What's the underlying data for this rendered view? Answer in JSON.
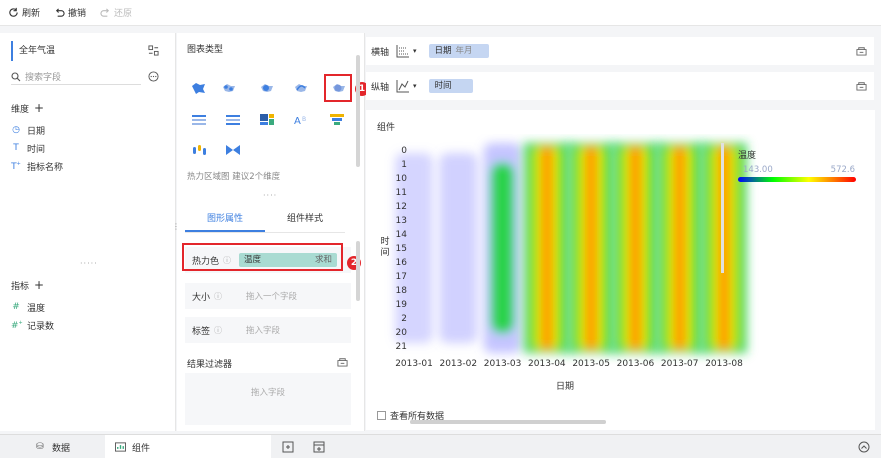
{
  "toolbar": {
    "refresh": "刷新",
    "undo": "撤销",
    "redo": "还原"
  },
  "left": {
    "dataset": "全年气温",
    "search_placeholder": "搜索字段",
    "dimension_title": "维度",
    "dimensions": [
      "日期",
      "时间",
      "指标名称"
    ],
    "measure_title": "指标",
    "measures": [
      "温度",
      "记录数"
    ]
  },
  "mid": {
    "chart_type_title": "图表类型",
    "chart_hint": "热力区域图 建议2个维度",
    "tabs": [
      "图形属性",
      "组件样式"
    ],
    "heat_label": "热力色",
    "heat_field": "温度",
    "heat_agg": "求和",
    "size_label": "大小",
    "size_hint": "拖入一个字段",
    "tag_label": "标签",
    "tag_hint": "拖入字段",
    "filter_title": "结果过滤器",
    "filter_hint": "拖入字段",
    "annotation_1": "1",
    "annotation_2": "2"
  },
  "right": {
    "x_axis_label": "横轴",
    "x_field": "日期",
    "x_field_sub": "年月",
    "y_axis_label": "纵轴",
    "y_field": "时间",
    "component_title": "组件",
    "show_all": "查看所有数据"
  },
  "chart_data": {
    "type": "heatmap",
    "x_categories": [
      "2013-01",
      "2013-02",
      "2013-03",
      "2013-04",
      "2013-05",
      "2013-06",
      "2013-07",
      "2013-08"
    ],
    "y_categories": [
      "0",
      "1",
      "10",
      "11",
      "12",
      "13",
      "14",
      "15",
      "16",
      "17",
      "18",
      "19",
      "2",
      "20",
      "21"
    ],
    "xlabel": "日期",
    "ylabel": "时间",
    "legend_title": "温度",
    "color_min": 143.0,
    "color_max": 572.6,
    "color_min_label": "143.00",
    "color_max_label": "572.6",
    "gradient": [
      "#0000ff",
      "#00ff00",
      "#ffff00",
      "#ff8000",
      "#ff0000"
    ],
    "hotspots": [
      {
        "x": "2013-01",
        "intensity": 0.12
      },
      {
        "x": "2013-02",
        "intensity": 0.15
      },
      {
        "x": "2013-03",
        "intensity": 0.45
      },
      {
        "x": "2013-04",
        "intensity": 0.7
      },
      {
        "x": "2013-05",
        "intensity": 0.88
      },
      {
        "x": "2013-06",
        "intensity": 0.93
      },
      {
        "x": "2013-07",
        "intensity": 1.0
      },
      {
        "x": "2013-08",
        "intensity": 0.95
      }
    ]
  },
  "bottom": {
    "data_tab": "数据",
    "component_tab": "组件"
  },
  "colors": {
    "accent": "#3d7fe0",
    "annotation": "#e3262b"
  }
}
